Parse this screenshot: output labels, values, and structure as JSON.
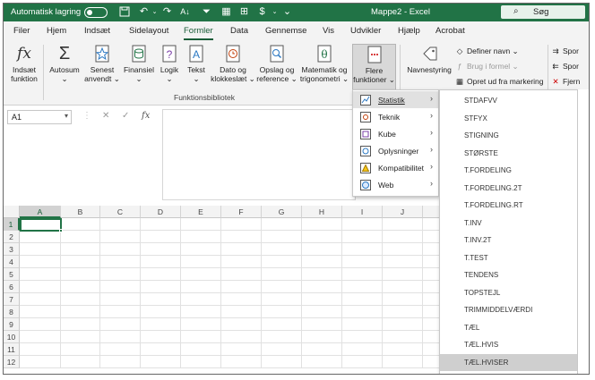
{
  "titlebar": {
    "autosave_label": "Automatisk lagring",
    "document_title": "Mappe2  -  Excel",
    "search_label": "Søg"
  },
  "tabs": [
    "Filer",
    "Hjem",
    "Indsæt",
    "Sidelayout",
    "Formler",
    "Data",
    "Gennemse",
    "Vis",
    "Udvikler",
    "Hjælp",
    "Acrobat"
  ],
  "active_tab": "Formler",
  "ribbon": {
    "insert_function": {
      "line1": "Indsæt",
      "line2": "funktion"
    },
    "autosum": {
      "line1": "Autosum",
      "line2": "⌄"
    },
    "recent": {
      "line1": "Senest",
      "line2": "anvendt ⌄"
    },
    "financial": {
      "line1": "Finansiel",
      "line2": "⌄"
    },
    "logical": {
      "line1": "Logik",
      "line2": "⌄"
    },
    "text": {
      "line1": "Tekst",
      "line2": "⌄"
    },
    "datetime": {
      "line1": "Dato og",
      "line2": "klokkeslæt ⌄"
    },
    "lookup": {
      "line1": "Opslag og",
      "line2": "reference ⌄"
    },
    "math": {
      "line1": "Matematik og",
      "line2": "trigonometri ⌄"
    },
    "more": {
      "line1": "Flere",
      "line2": "funktioner ⌄"
    },
    "name_manager": "Navnestyring",
    "define_name": "Definer navn ⌄",
    "use_in_formula": "Brug i formel ⌄",
    "create_from_selection": "Opret ud fra markering",
    "trace1": "Spor",
    "trace2": "Spor",
    "remove": "Fjern",
    "group_label": "Funktionsbibliotek"
  },
  "formula_bar": {
    "name_box": "A1",
    "fx_label": "fx"
  },
  "grid": {
    "columns": [
      "A",
      "B",
      "C",
      "D",
      "E",
      "F",
      "G",
      "H",
      "I",
      "J"
    ],
    "rows": [
      "1",
      "2",
      "3",
      "4",
      "5",
      "6",
      "7",
      "8",
      "9",
      "10",
      "11",
      "12"
    ],
    "selected_cell": "A1"
  },
  "more_functions_menu": [
    {
      "label": "Statistik",
      "icon": "statistics-icon",
      "hover": true
    },
    {
      "label": "Teknik",
      "icon": "engineering-icon",
      "hover": false
    },
    {
      "label": "Kube",
      "icon": "cube-icon",
      "hover": false
    },
    {
      "label": "Oplysninger",
      "icon": "information-icon",
      "hover": false
    },
    {
      "label": "Kompatibilitet",
      "icon": "compatibility-icon",
      "hover": false
    },
    {
      "label": "Web",
      "icon": "web-icon",
      "hover": false
    }
  ],
  "statistics_submenu": [
    "STDAFVV",
    "STFYX",
    "STIGNING",
    "STØRSTE",
    "T.FORDELING",
    "T.FORDELING.2T",
    "T.FORDELING.RT",
    "T.INV",
    "T.INV.2T",
    "T.TEST",
    "TENDENS",
    "TOPSTEJL",
    "TRIMMIDDELVÆRDI",
    "TÆL",
    "TÆL.HVIS",
    "TÆL.HVISER"
  ],
  "statistics_submenu_hover": "TÆL.HVISER",
  "colors": {
    "excel_green": "#217346",
    "dark_green": "#185c37",
    "ribbon_bg": "#f3f3f3"
  }
}
